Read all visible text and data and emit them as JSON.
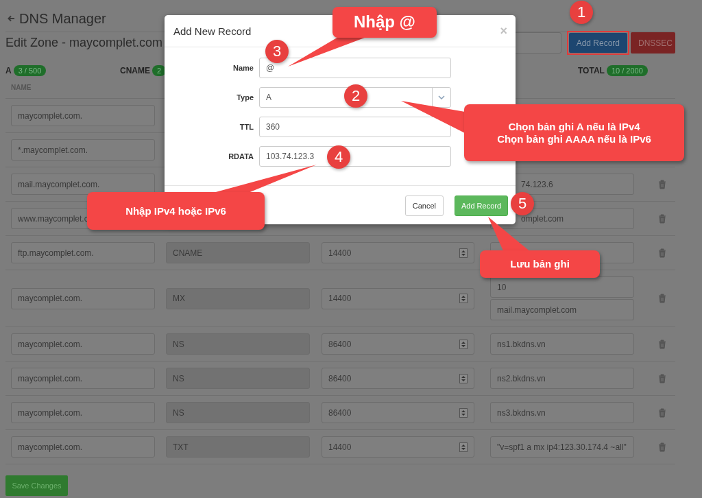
{
  "header": {
    "title": "DNS Manager"
  },
  "zone": {
    "title": "Edit Zone - maycomplet.com",
    "buttons": [
      {
        "label": "Add Record",
        "kind": "primary",
        "highlighted": true
      },
      {
        "label": "DNSSEC",
        "kind": "danger",
        "highlighted": false
      }
    ]
  },
  "counters": [
    {
      "label": "A",
      "value": "3 / 500"
    },
    {
      "label": "CNAME",
      "value": "2"
    },
    {
      "label": "TOTAL",
      "value": "10 / 2000"
    }
  ],
  "table": {
    "columns": [
      "NAME"
    ],
    "rows": [
      {
        "name": "maycomplet.com.",
        "deletable": false
      },
      {
        "name": "*.maycomplet.com.",
        "deletable": false
      },
      {
        "name": "mail.maycomplet.com.",
        "rdata": [
          "74.123.6"
        ],
        "rdata_cut_by_dialog": true,
        "deletable": true
      },
      {
        "name": "www.maycomplet.c",
        "rdata": [
          "omplet.com"
        ],
        "rdata_cut_by_dialog": true,
        "deletable": true
      },
      {
        "name": "ftp.maycomplet.com.",
        "type": "CNAME",
        "ttl": "14400",
        "deletable": true
      },
      {
        "name": "maycomplet.com.",
        "type": "MX",
        "ttl": "14400",
        "rdata": [
          "10",
          "mail.maycomplet.com"
        ],
        "deletable": true
      },
      {
        "name": "maycomplet.com.",
        "type": "NS",
        "ttl": "86400",
        "rdata": [
          "ns1.bkdns.vn"
        ],
        "deletable": true
      },
      {
        "name": "maycomplet.com.",
        "type": "NS",
        "ttl": "86400",
        "rdata": [
          "ns2.bkdns.vn"
        ],
        "deletable": true
      },
      {
        "name": "maycomplet.com.",
        "type": "NS",
        "ttl": "86400",
        "rdata": [
          "ns3.bkdns.vn"
        ],
        "deletable": true
      },
      {
        "name": "maycomplet.com.",
        "type": "TXT",
        "ttl": "14400",
        "rdata": [
          "\"v=spf1 a mx ip4:123.30.174.4 ~all\""
        ],
        "deletable": true
      }
    ]
  },
  "save_button": "Save Changes",
  "dialog": {
    "title": "Add New Record",
    "close": "×",
    "fields": [
      {
        "label": "Name",
        "kind": "text",
        "value": "@"
      },
      {
        "label": "Type",
        "kind": "select",
        "value": "A"
      },
      {
        "label": "TTL",
        "kind": "text",
        "value": "360"
      },
      {
        "label": "RDATA",
        "kind": "text",
        "value": "103.74.123.3"
      }
    ],
    "buttons": [
      {
        "label": "Cancel",
        "kind": "default"
      },
      {
        "label": "Add Record",
        "kind": "success"
      }
    ]
  },
  "annotations": {
    "steps": [
      "1",
      "2",
      "3",
      "4",
      "5"
    ],
    "callouts": [
      {
        "lines": [
          "Nhập @"
        ]
      },
      {
        "lines": [
          "Chọn bản ghi A nếu là IPv4",
          "Chọn bản ghi AAAA nếu là IPv6"
        ]
      },
      {
        "lines": [
          "Nhập IPv4 hoặc IPv6"
        ]
      },
      {
        "lines": [
          "Lưu bản ghi"
        ]
      }
    ]
  }
}
